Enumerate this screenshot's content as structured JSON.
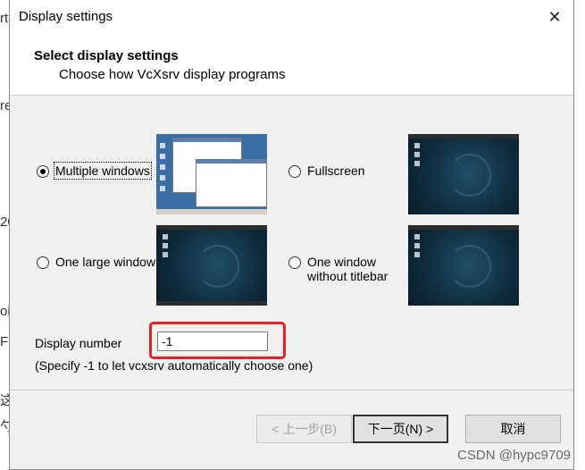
{
  "window": {
    "title": "Display settings",
    "close_glyph": "✕"
  },
  "header": {
    "title": "Select display settings",
    "subtitle": "Choose how VcXsrv display programs"
  },
  "options": [
    {
      "label": "Multiple windows",
      "selected": true
    },
    {
      "label": "Fullscreen",
      "selected": false
    },
    {
      "label": "One large window",
      "selected": false
    },
    {
      "label": "One window",
      "label2": "without titlebar",
      "selected": false
    }
  ],
  "display_number": {
    "label": "Display number",
    "value": "-1",
    "hint": "(Specify -1 to let vcxsrv automatically choose one)"
  },
  "buttons": {
    "back": "< 上一步(B)",
    "next": "下一页(N) >",
    "cancel": "取消"
  },
  "watermark": "CSDN @hypc9709",
  "background_fragments": [
    "rt",
    "re",
    "20",
    "oi",
    "F",
    "这",
    "勺"
  ],
  "colors": {
    "highlight": "#e8201f",
    "desktop": "#0f2c3d",
    "win_desktop": "#3a6ea5"
  }
}
